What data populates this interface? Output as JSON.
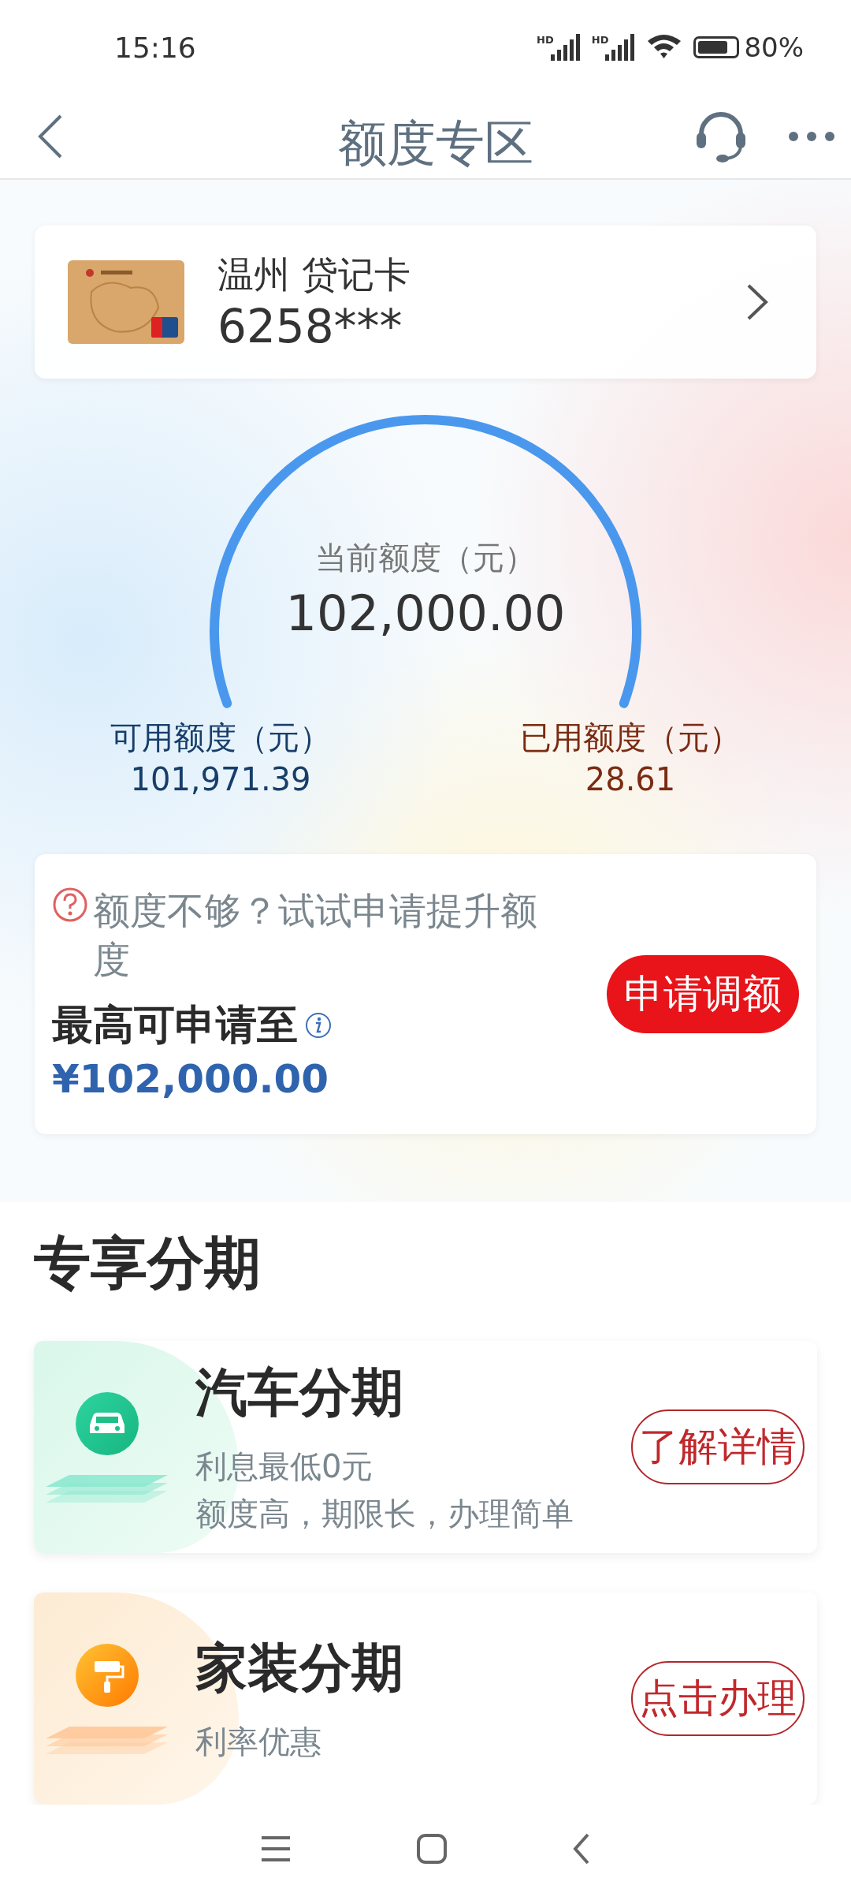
{
  "status_bar": {
    "time": "15:16",
    "signals": [
      {
        "label": "HD"
      },
      {
        "label": "HD"
      }
    ],
    "battery": {
      "text": "80%"
    }
  },
  "nav": {
    "title": "额度专区"
  },
  "card": {
    "name": "温州 贷记卡",
    "number": "6258***"
  },
  "gauge": {
    "label": "当前额度（元）",
    "amount": "102,000.00",
    "available": {
      "label": "可用额度（元）",
      "value": "101,971.39"
    },
    "used": {
      "label": "已用额度（元）",
      "value": "28.61"
    }
  },
  "upgrade": {
    "question": "额度不够？试试申请提升额度",
    "max_label": "最高可申请至",
    "max_value": "¥102,000.00",
    "button": "申请调额"
  },
  "section_title": "专享分期",
  "products": [
    {
      "kind": "car",
      "title": "汽车分期",
      "lines": [
        "利息最低0元",
        "额度高，期限长，办理简单"
      ],
      "button": "了解详情"
    },
    {
      "kind": "decor",
      "title": "家装分期",
      "lines": [
        "利率优惠"
      ],
      "button": "点击办理"
    }
  ]
}
